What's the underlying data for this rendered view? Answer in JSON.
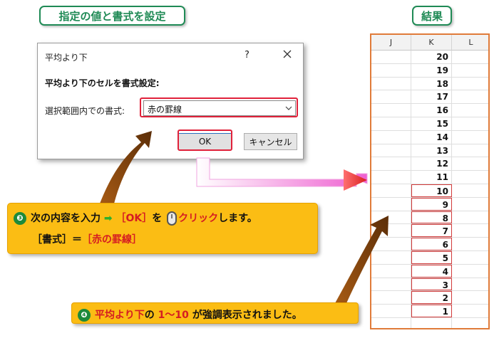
{
  "tags": {
    "left": "指定の値と書式を設定",
    "right": "結果"
  },
  "dialog": {
    "title": "平均より下",
    "help": "?",
    "heading": "平均より下のセルを書式設定:",
    "format_label": "選択範囲内での書式:",
    "format_value": "赤の罫線",
    "ok": "OK",
    "cancel": "キャンセル"
  },
  "sheet": {
    "columns": [
      "J",
      "K",
      "L"
    ],
    "values": [
      "20",
      "19",
      "18",
      "17",
      "16",
      "15",
      "14",
      "13",
      "12",
      "11",
      "10",
      "9",
      "8",
      "7",
      "6",
      "5",
      "4",
      "3",
      "2",
      "1",
      ""
    ],
    "highlighted": [
      "10",
      "9",
      "8",
      "7",
      "6",
      "5",
      "4",
      "3",
      "2",
      "1"
    ]
  },
  "callout3": {
    "step": "❸",
    "part1": "次の内容を入力",
    "arrow": "➡",
    "ok": "［OK］",
    "part2": "を",
    "part3": "クリック",
    "part4": "します。",
    "line2_a": "［書式］＝",
    "line2_b": "［赤の罫線］"
  },
  "callout4": {
    "step": "❹",
    "part1": "平均より下",
    "part2": "の",
    "part3": "1～10",
    "part4": "が強調表示されました。"
  },
  "colors": {
    "accent_green": "#1f8a55",
    "callout": "#fbbd14",
    "highlight_red": "#e0213a",
    "arrow_pink": "#f28ad6",
    "arrow_brown": "#8a4a12"
  }
}
